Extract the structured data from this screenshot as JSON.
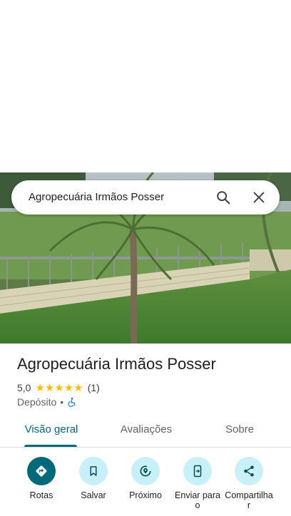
{
  "search": {
    "value": "Agropecuária Irmãos Posser"
  },
  "place": {
    "name": "Agropecuária Irmãos Posser",
    "rating": "5,0",
    "stars": "★★★★★",
    "review_count": "(1)",
    "category": "Depósito",
    "separator": "•"
  },
  "tabs": [
    {
      "label": "Visão geral",
      "selected": true
    },
    {
      "label": "Avaliações",
      "selected": false
    },
    {
      "label": "Sobre",
      "selected": false
    }
  ],
  "actions": [
    {
      "label": "Rotas",
      "icon": "directions-icon"
    },
    {
      "label": "Salvar",
      "icon": "bookmark-icon"
    },
    {
      "label": "Próximo",
      "icon": "nearby-icon"
    },
    {
      "label": "Enviar para\no",
      "icon": "send-to-phone-icon"
    },
    {
      "label": "Compartilha\nr",
      "icon": "share-icon"
    }
  ],
  "colors": {
    "accent": "#00697a",
    "action_bg": "#c7f0f8",
    "star": "#fbbc04"
  }
}
